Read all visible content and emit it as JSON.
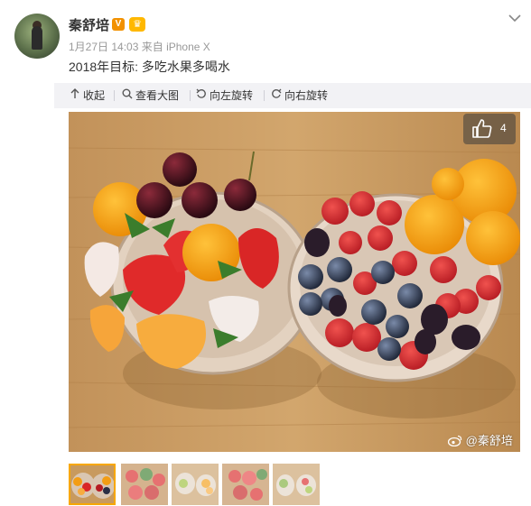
{
  "post": {
    "author_name": "秦舒培",
    "verified_badge": "V",
    "vip_badge": "♛",
    "meta_time": "1月27日 14:03",
    "meta_source": "来自 iPhone X",
    "text": "2018年目标: 多吃水果多喝水"
  },
  "toolbar": {
    "collapse": "收起",
    "view_large": "查看大图",
    "rotate_left": "向左旋转",
    "rotate_right": "向右旋转"
  },
  "image": {
    "like_count": "4",
    "watermark": "@秦舒培"
  },
  "icons": {
    "chevron": "chevron-down-icon",
    "collapse": "arrow-up-icon",
    "view_large": "magnifier-icon",
    "rotate_left": "rotate-left-icon",
    "rotate_right": "rotate-right-icon",
    "like": "thumbs-up-icon",
    "weibo": "weibo-logo-icon"
  },
  "colors": {
    "toolbar_bg": "#f2f2f5",
    "active_thumb_border": "#f7a700",
    "verified_badge": "#f29100"
  },
  "thumbnails": [
    {
      "id": "thumb-1",
      "active": true
    },
    {
      "id": "thumb-2",
      "active": false
    },
    {
      "id": "thumb-3",
      "active": false
    },
    {
      "id": "thumb-4",
      "active": false
    },
    {
      "id": "thumb-5",
      "active": false
    }
  ]
}
